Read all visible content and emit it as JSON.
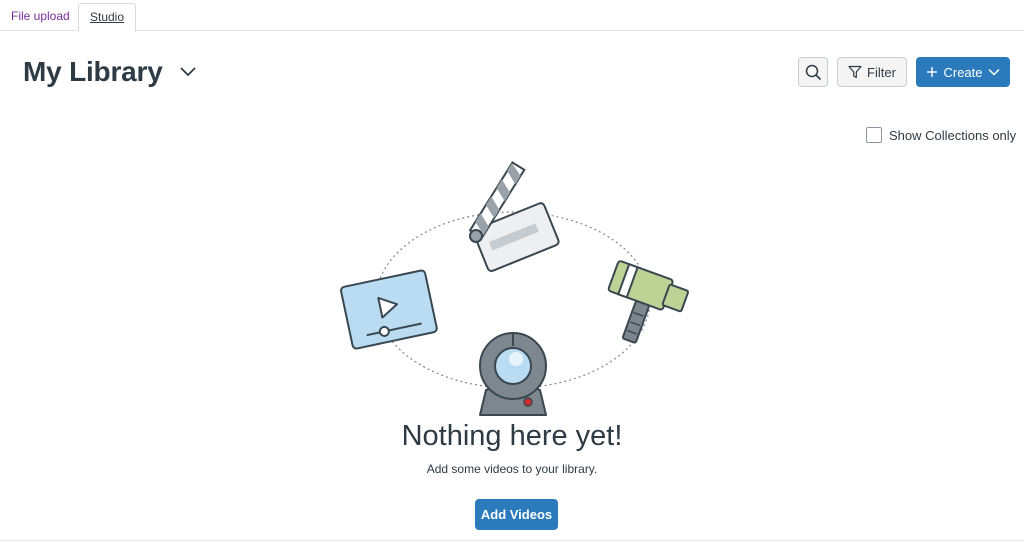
{
  "tabs": [
    {
      "label": "File upload"
    },
    {
      "label": "Studio"
    }
  ],
  "header": {
    "title": "My Library"
  },
  "toolbar": {
    "filter_label": "Filter",
    "create_label": "Create"
  },
  "options": {
    "show_collections_label": "Show Collections only",
    "show_collections_checked": false
  },
  "empty_state": {
    "heading": "Nothing here yet!",
    "subtext": "Add some videos to your library.",
    "button_label": "Add Videos"
  },
  "colors": {
    "primary": "#2b7abc",
    "text": "#2d3b45",
    "link_purple": "#7b2e9b"
  },
  "icons": [
    "chevron-down-icon",
    "search-icon",
    "filter-icon",
    "plus-icon",
    "clapperboard-icon",
    "video-player-icon",
    "video-camera-icon",
    "webcam-icon"
  ]
}
